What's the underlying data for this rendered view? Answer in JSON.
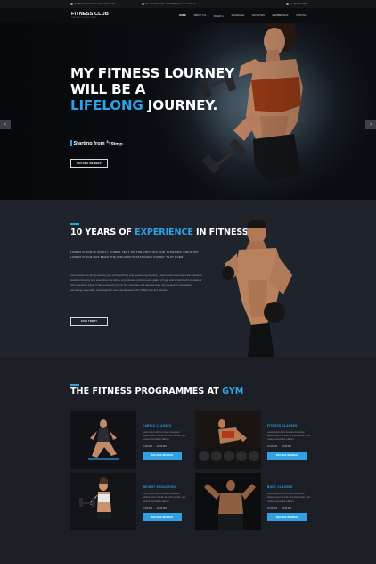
{
  "topbar": {
    "address": "52, Broadway 12, New York, USA 3173",
    "hours": "Mon - Fri 09:00AM - 06:00PM  |  Sat - Sun: Closed",
    "phone": "+1 247 234 7896"
  },
  "nav": {
    "logo_main": "FITNESS CLUB",
    "logo_tag": "THE BEST GYM IN TOWN",
    "menu": [
      "HOME",
      "ABOUT US",
      "PAGES",
      "SCHEDULE",
      "FACILITIES",
      "MEMBERSHIP",
      "CONTACT"
    ]
  },
  "hero": {
    "title_line1": "MY FITNESS LOURNEY",
    "title_line2": "WILL BE A",
    "title_accent": "LIFELONG",
    "title_line3_rest": " JOURNEY.",
    "subtitle_prefix": "Starting from ",
    "price_symbol": "$",
    "price": "19",
    "price_suffix": "/mp",
    "button": "BECOME MEMBER",
    "prev_icon": "chevron-left-icon",
    "next_icon": "chevron-right-icon",
    "slide_count": 3,
    "active_slide": 2
  },
  "experience": {
    "title_pre": "10 YEARS OF ",
    "title_accent": "EXPERIENCE",
    "title_post": " IN FITNESS",
    "caps": "LOREM IPSUM IS SIMPLY DUMMY TEXT OF THE PRINTING AND TYPESING INDUSTRY LOREM IPSUM HAS BEEN THE INDUSTRYS STANDARD DUMMY TEXT EVER.",
    "paragraph": "Lorem Ipsum is simply dummy text of the printing and typesetting industry. Lorem Ipsum has been the industrys standard dummy text ever since the when, an unknown printer took a galley of type and scrambled it to make a type specimen book. It has survived not only five centuries, but also the leap into electronic typesetting, remaining essentially unchanged. It was popularised in the 1960s with the release.",
    "button": "JOIN TODAY"
  },
  "programmes": {
    "title_pre": "THE FITNESS PROGRAMMES AT ",
    "title_accent": "GYM",
    "cards": [
      {
        "title": "CARDIO CLASSES",
        "desc": "Lorem ipsum dolor sit amet consectetur adipiscing elit. Ut enim ad minim veniam, quis nostrud exercitation ullamco.",
        "time_start": "11:00 AM",
        "time_end": "12:00 AM",
        "button": "BECOME MEMBER"
      },
      {
        "title": "FITNESS CLASSES",
        "desc": "Lorem ipsum dolor sit amet consectetur adipiscing elit. Ut enim ad minim veniam, quis nostrud exercitation ullamco.",
        "time_start": "11:00 AM",
        "time_end": "12:00 AM",
        "button": "BECOME MEMBER"
      },
      {
        "title": "WEIGHT REDUCTION",
        "desc": "Lorem ipsum dolor sit amet consectetur adipiscing elit. Ut enim ad minim veniam, quis nostrud exercitation ullamco.",
        "time_start": "11:00 AM",
        "time_end": "12:00 AM",
        "button": "BECOME MEMBER"
      },
      {
        "title": "BODY CLASSES",
        "desc": "Lorem ipsum dolor sit amet consectetur adipiscing elit. Ut enim ad minim veniam, quis nostrud exercitation ullamco.",
        "time_start": "11:00 AM",
        "time_end": "12:00 AM",
        "button": "BECOME MEMBER"
      }
    ]
  },
  "colors": {
    "accent": "#2ea0e3",
    "background": "#1d2027",
    "nav": "#0c0d10"
  }
}
